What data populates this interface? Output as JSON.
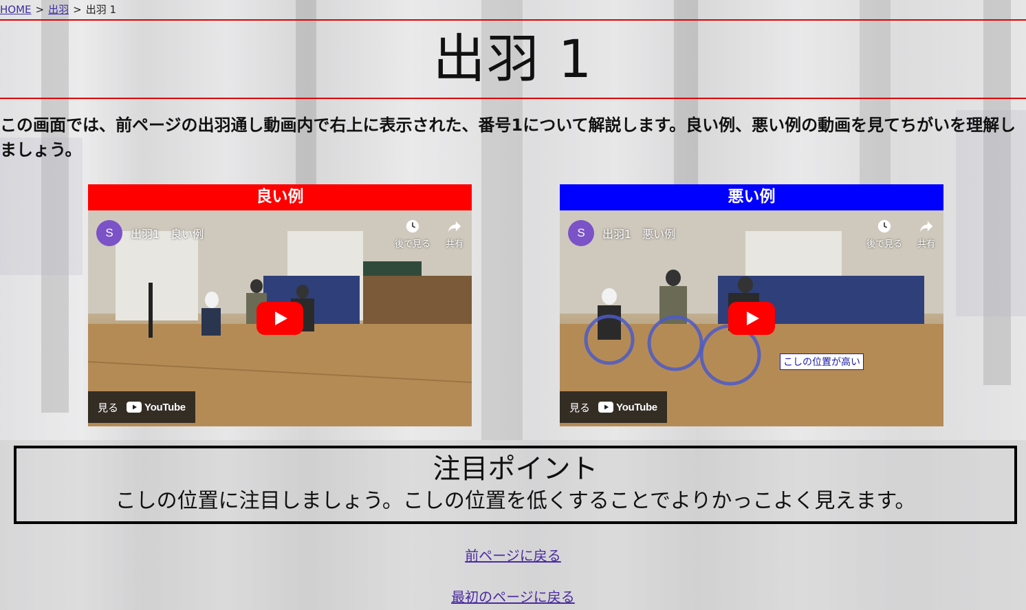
{
  "breadcrumb": {
    "home": "HOME",
    "sep1": ">",
    "parent": "出羽",
    "sep2": ">",
    "current": "出羽 1"
  },
  "page": {
    "title": "出羽 1",
    "intro": "この画面では、前ページの出羽通し動画内で右上に表示された、番号1について解説します。良い例、悪い例の動画を見てちがいを理解しましょう。"
  },
  "videos": [
    {
      "header": "良い例",
      "header_color": "#ff0000",
      "channel_initial": "S",
      "video_title": "出羽1　良い例",
      "watch_later": "後で見る",
      "share": "共有",
      "watch_on": "見る",
      "youtube": "YouTube"
    },
    {
      "header": "悪い例",
      "header_color": "#0000ff",
      "channel_initial": "S",
      "video_title": "出羽1　悪い例",
      "watch_later": "後で見る",
      "share": "共有",
      "watch_on": "見る",
      "youtube": "YouTube",
      "caption": "こしの位置が高い"
    }
  ],
  "point": {
    "title": "注目ポイント",
    "text": "こしの位置に注目しましょう。こしの位置を低くすることでよりかっこよく見えます。"
  },
  "links": {
    "prev": "前ページに戻る",
    "first": "最初のページに戻る"
  },
  "colors": {
    "accent_line": "#e00000",
    "link": "#4a2aa0",
    "avatar": "#7b52c7"
  },
  "icons": [
    "clock-icon",
    "share-icon",
    "play-icon",
    "youtube-logo-icon"
  ]
}
